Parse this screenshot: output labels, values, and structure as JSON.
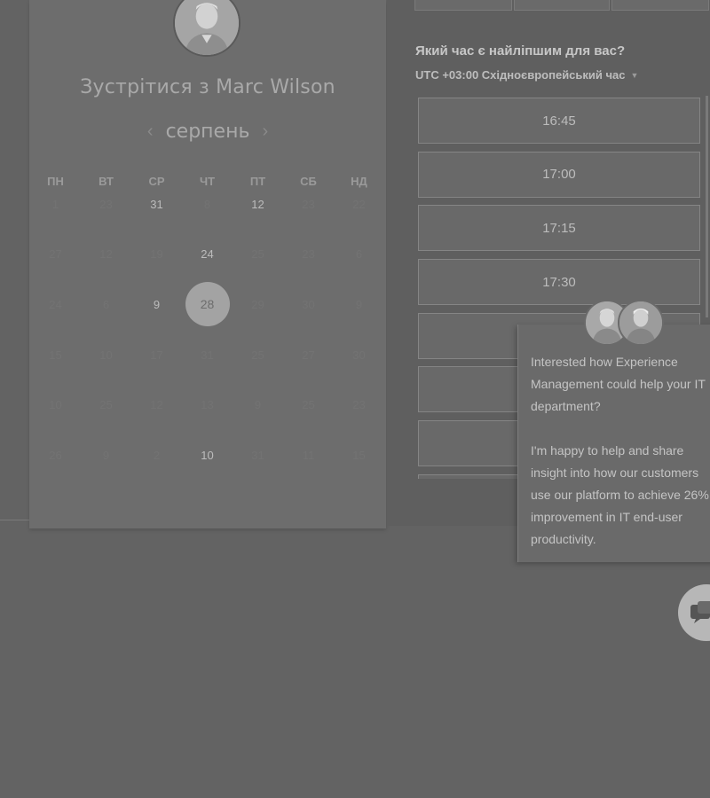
{
  "calendar": {
    "title": "Зустрітися з Marc Wilson",
    "month": "серпень",
    "weekdays": [
      "ПН",
      "ВТ",
      "СР",
      "ЧТ",
      "ПТ",
      "СБ",
      "НД"
    ],
    "days": [
      [
        "1",
        "23",
        "31",
        "8",
        "12",
        "23",
        "22"
      ],
      [
        "27",
        "12",
        "19",
        "24",
        "25",
        "23",
        "6"
      ],
      [
        "24",
        "6",
        "9",
        "28",
        "29",
        "30",
        "9"
      ],
      [
        "15",
        "10",
        "17",
        "31",
        "25",
        "27",
        "30"
      ],
      [
        "10",
        "25",
        "12",
        "13",
        "9",
        "25",
        "23"
      ],
      [
        "26",
        "9",
        "2",
        "10",
        "31",
        "11",
        "15"
      ]
    ],
    "selected_day": "28"
  },
  "times": {
    "question": "Який час є найліпшим для вас?",
    "timezone": "UTC +03:00 Східноєвропейський час",
    "slots": [
      "16:45",
      "17:00",
      "17:15",
      "17:30",
      "",
      "",
      "",
      ""
    ]
  },
  "chat": {
    "message": "Interested how Experience Management could help your IT department?\n\nI'm happy to help and share insight into how our customers use our platform to achieve 26% improvement in IT end-user productivity."
  }
}
